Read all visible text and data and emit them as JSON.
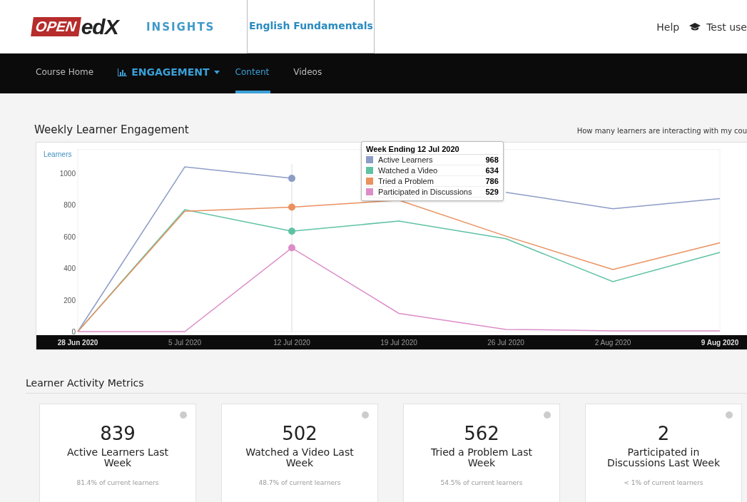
{
  "header": {
    "logo_left": "OPEN",
    "logo_right": "edX",
    "product": "INSIGHTS",
    "course": "English Fundamentals",
    "help": "Help",
    "user": "Test use"
  },
  "nav": [
    {
      "label": "Course Home",
      "kind": "link",
      "selected": false
    },
    {
      "label": "ENGAGEMENT",
      "kind": "dropdown",
      "selected": false
    },
    {
      "label": "Content",
      "kind": "link",
      "selected": true
    },
    {
      "label": "Videos",
      "kind": "link",
      "selected": false
    }
  ],
  "engagement": {
    "title": "Weekly Learner Engagement",
    "question": "How many learners are interacting with my cou",
    "chart_data": {
      "type": "line",
      "ylabel": "Learners",
      "categories": [
        "28 Jun 2020",
        "5 Jul 2020",
        "12 Jul 2020",
        "19 Jul 2020",
        "26 Jul 2020",
        "2 Aug 2020",
        "9 Aug 2020"
      ],
      "ylim": [
        0,
        1150
      ],
      "yticks": [
        0,
        200,
        400,
        600,
        800,
        1000
      ],
      "series": [
        {
          "name": "Active Learners",
          "color": "#8d9cc7",
          "values": [
            0,
            1040,
            968,
            null,
            880,
            776,
            840
          ]
        },
        {
          "name": "Watched a Video",
          "color": "#5fc2a5",
          "values": [
            0,
            770,
            634,
            698,
            587,
            315,
            500
          ]
        },
        {
          "name": "Tried a Problem",
          "color": "#e9915f",
          "values": [
            0,
            760,
            786,
            830,
            603,
            392,
            561
          ]
        },
        {
          "name": "Participated in Discussions",
          "color": "#dc8dc8",
          "values": [
            0,
            0,
            529,
            115,
            14,
            5,
            5
          ]
        }
      ],
      "annotations": [
        {
          "x": "12 Jul 2020"
        }
      ]
    },
    "tooltip": {
      "title": "Week Ending 12 Jul 2020",
      "rows": [
        {
          "value": "968"
        },
        {
          "value": "634"
        },
        {
          "value": "786"
        },
        {
          "value": "529"
        }
      ]
    }
  },
  "metrics": {
    "title": "Learner Activity Metrics",
    "cards": [
      {
        "value": "839",
        "label": "Active Learners Last Week",
        "note": "81.4% of current learners"
      },
      {
        "value": "502",
        "label": "Watched a Video Last Week",
        "note": "48.7% of current learners"
      },
      {
        "value": "562",
        "label": "Tried a Problem Last Week",
        "note": "54.5% of current learners"
      },
      {
        "value": "2",
        "label": "Participated in Discussions Last Week",
        "note": "< 1% of current learners"
      }
    ]
  }
}
